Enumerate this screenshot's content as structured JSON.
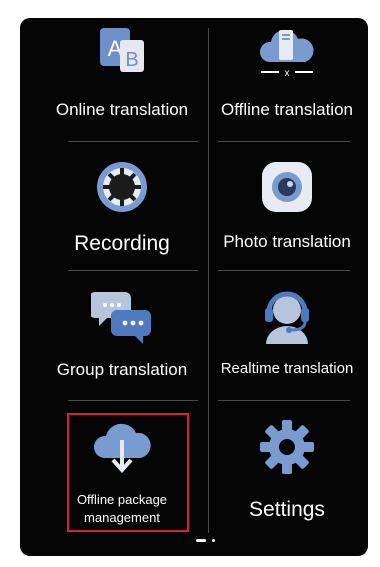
{
  "menu": {
    "items": [
      {
        "label": "Online translation",
        "icon": "ab-translate-icon"
      },
      {
        "label": "Offline translation",
        "icon": "offline-cloud-icon"
      },
      {
        "label": "Recording",
        "icon": "recording-icon"
      },
      {
        "label": "Photo translation",
        "icon": "camera-icon"
      },
      {
        "label": "Group translation",
        "icon": "chat-bubbles-icon"
      },
      {
        "label": "Realtime translation",
        "icon": "headset-icon"
      },
      {
        "label_line1": "Offline package",
        "label_line2": "management",
        "icon": "cloud-download-icon"
      },
      {
        "label": "Settings",
        "icon": "gear-icon"
      }
    ]
  },
  "colors": {
    "background": "#050505",
    "icon_blue": "#7a9bd0",
    "icon_dark": "#3a5f99",
    "highlight": "#d8222c"
  },
  "pager": {
    "pages": 2,
    "current": 1
  }
}
